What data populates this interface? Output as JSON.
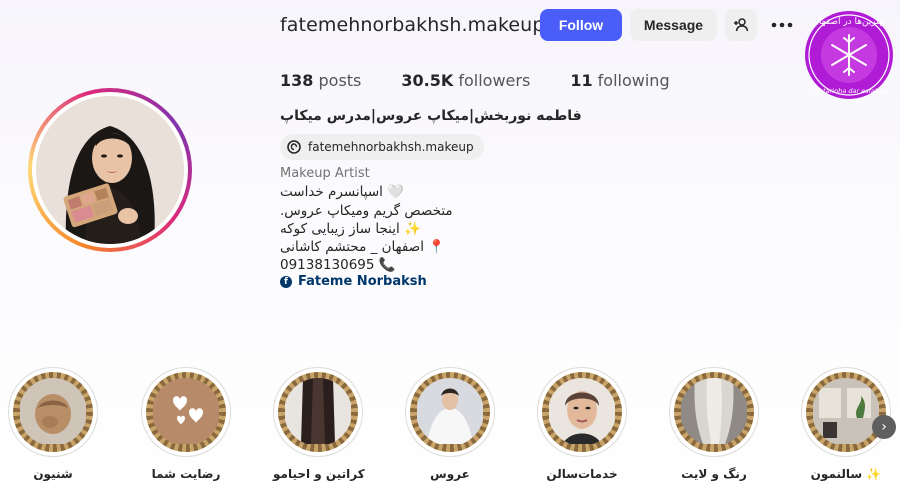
{
  "profile": {
    "username": "fatemehnorbakhsh.makeup",
    "follow_label": "Follow",
    "message_label": "Message",
    "posts_count": "138",
    "posts_label": "posts",
    "followers_count": "30.5K",
    "followers_label": "followers",
    "following_count": "11",
    "following_label": "following",
    "full_name": "فاطمه نوربخش|میکاپ عروس|مدرس میکاپ",
    "threads_handle": "fatemehnorbakhsh.makeup",
    "category": "Makeup Artist",
    "bio_lines": [
      "اسپانسرم خداست 🤍",
      ".متخصص گریم ومیکاپ عروس",
      "اینجا ساز زیبایی کوکه ✨",
      "اصفهان _ محتشم کاشانی 📍",
      "09138130695 📞"
    ],
    "facebook_link": "Fateme Norbaksh"
  },
  "watermark": {
    "text_top": "بهترین‌ها در اصفهان",
    "text_bottom": "behtarinha dar esfahan"
  },
  "highlights": [
    {
      "label": "شنیون",
      "theme": "hair"
    },
    {
      "label": "رضایت شما",
      "theme": "hearts"
    },
    {
      "label": "کراتین و احیامو",
      "theme": "straight"
    },
    {
      "label": "عروس",
      "theme": "bride"
    },
    {
      "label": "خدمات‌سالن",
      "theme": "face"
    },
    {
      "label": "رنگ و لایت",
      "theme": "blonde"
    },
    {
      "label": "سالنمون ✨",
      "theme": "salon"
    }
  ],
  "colors": {
    "follow_button": "#4a5df9",
    "link": "#00376b",
    "story_ring": [
      "#f58529",
      "#feda77",
      "#dd2a7b",
      "#8134af"
    ]
  }
}
